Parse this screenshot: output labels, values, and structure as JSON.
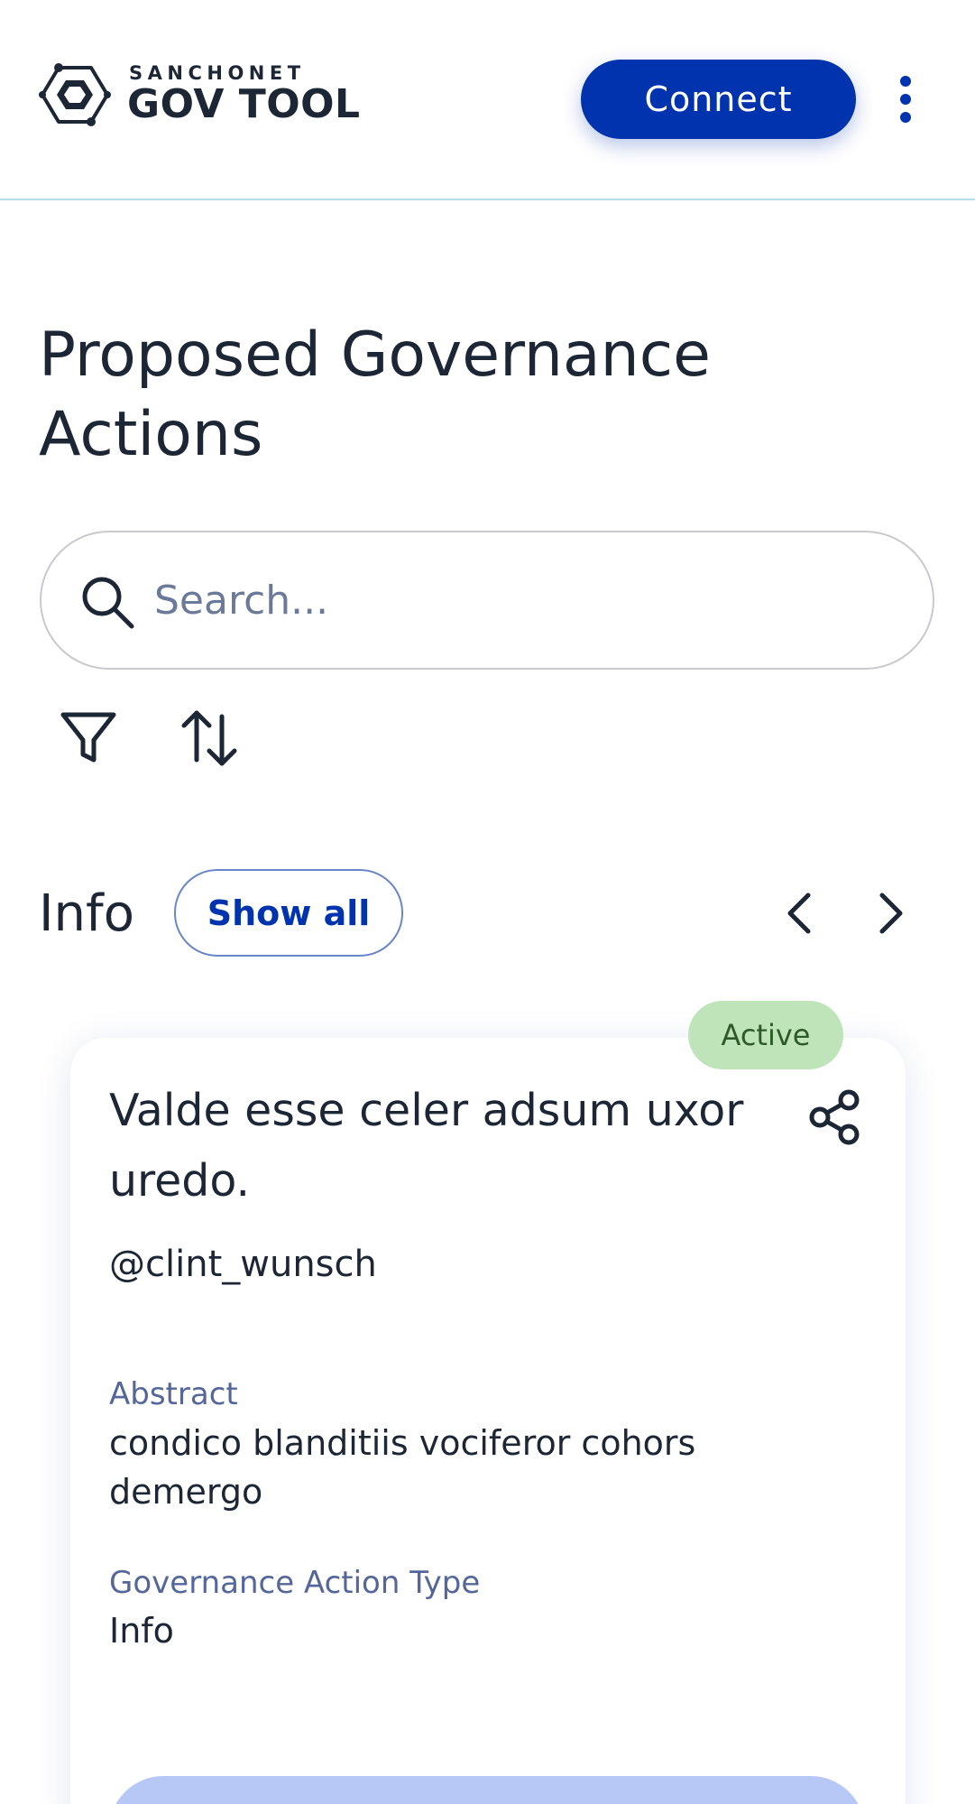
{
  "header": {
    "logo_super": "SANCHONET",
    "logo_title": "GOV TOOL",
    "connect_label": "Connect",
    "menu_icon": "kebab-menu-icon"
  },
  "page": {
    "title": "Proposed Governance Actions"
  },
  "search": {
    "placeholder": "Search...",
    "value": "",
    "icon": "search-icon"
  },
  "toolbar": {
    "filter_icon": "filter-icon",
    "sort_icon": "sort-icon"
  },
  "section": {
    "title": "Info",
    "show_all_label": "Show all",
    "prev_icon": "chevron-left-icon",
    "next_icon": "chevron-right-icon"
  },
  "card": {
    "status": "Active",
    "title": "Valde esse celer adsum uxor uredo.",
    "author": "@clint_wunsch",
    "abstract_label": "Abstract",
    "abstract_value": "condico blanditiis vociferor cohors demergo",
    "type_label": "Governance Action Type",
    "type_value": "Info",
    "share_icon": "share-icon"
  },
  "colors": {
    "primary": "#0033ad",
    "status_active_bg": "#c0e4ba",
    "status_active_text": "#2e5a2a",
    "muted_label": "#55679a",
    "header_border": "#b7dbe8"
  }
}
